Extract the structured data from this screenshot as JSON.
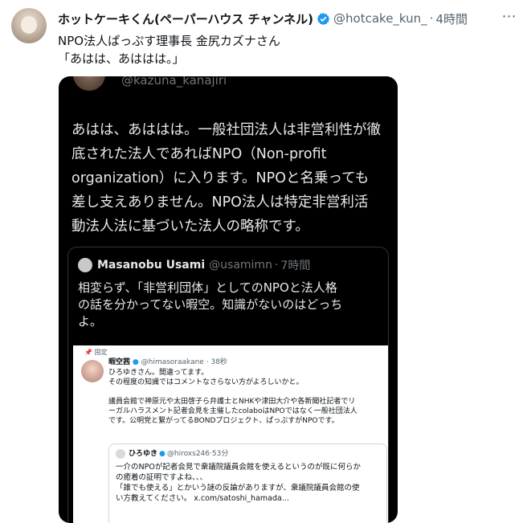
{
  "post": {
    "display_name": "ホットケーキくん(ペーパーハウス チャンネル)",
    "handle": "@hotcake_kun_",
    "separator": "·",
    "time": "4時間",
    "more_icon": "⋯",
    "text_lines": [
      "NPO法人ぱっぷす理事長 金尻カズナさん",
      "「あはは、あははは。」"
    ],
    "verified_color": "#1d9bf0"
  },
  "media": {
    "handle": "@kazuna_kanajiri",
    "body_lines": [
      "あはは、あははは。一般社団法人は非営利性が徹",
      "底された法人であればNPO（Non-profit",
      "organization）に入ります。NPOと名乗っても",
      "差し支えありません。NPO法人は特定非営利活",
      "動法人法に基づいた法人の略称です。"
    ],
    "quote": {
      "name": "Masanobu Usami",
      "handle": "@usamimn",
      "separator": "·",
      "time": "7時間",
      "lines": [
        "相変らず、「非営利団体」としてのNPOと法人格",
        "の話を分かってない暇空。知識がないのはどっち",
        "よ。"
      ],
      "screenshot": {
        "pinned_label": "固定",
        "name": "暇空茜",
        "handle": "@himasoraakane",
        "separator": "·",
        "time": "38秒",
        "lines": [
          "ひろゆきさん。間違ってます。",
          "その程度の知識ではコメントなさらない方がよろしいかと。",
          "",
          "議員会館で神原元や太田啓子ら弁護士とNHKや津田大介や各新聞社記者でリ",
          "ーガルハラスメント記者会見を主催したcolaboはNPOではなく一般社団法人",
          "です。公明党と繋がってるBONDプロジェクト、ぱっぷすがNPOです。"
        ],
        "inner_quote": {
          "name": "ひろゆき",
          "handle": "@hiroxs246",
          "separator": "·",
          "time": "53分",
          "lines": [
            "一介のNPOが記者会見で衆議院議員会館を使えるというのが既に何らか",
            "の癒着の証明ですよね、、、",
            "「誰でも使える」とかいう謎の反論がありますが、衆議院議員会館の使",
            "い方教えてください。 x.com/satoshi_hamada..."
          ]
        }
      }
    }
  }
}
